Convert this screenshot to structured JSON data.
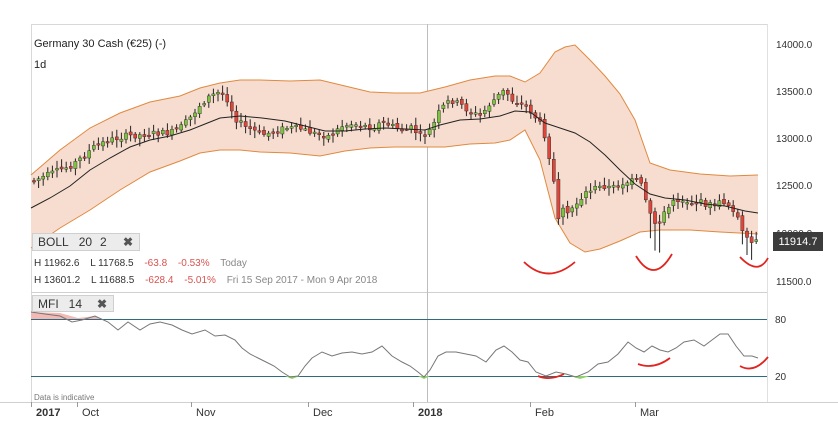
{
  "header": {
    "instrument": "Germany 30 Cash (€25) (-)",
    "timeframe": "1d"
  },
  "boll": {
    "label": "BOLL",
    "period": "20",
    "stddev": "2",
    "close_glyph": "✖"
  },
  "stats": {
    "row1": {
      "high": "H 11962.6",
      "low": "L 11768.5",
      "change": "-63.8",
      "pct": "-0.53%",
      "range": "Today"
    },
    "row2": {
      "high": "H 13601.2",
      "low": "L 11688.5",
      "change": "-628.4",
      "pct": "-5.01%",
      "range": "Fri 15 Sep 2017 - Mon 9 Apr 2018"
    }
  },
  "current_price": "11914.7",
  "mfi": {
    "label": "MFI",
    "period": "14",
    "close_glyph": "✖",
    "levels": [
      "80",
      "20"
    ]
  },
  "disclaimer": "Data is indicative",
  "x_axis": {
    "labels": [
      "2017",
      "Oct",
      "Nov",
      "Dec",
      "2018",
      "Feb",
      "Mar"
    ]
  },
  "y_axis": {
    "labels": [
      "14000.0",
      "13500.0",
      "13000.0",
      "12500.0",
      "12000.0",
      "11500.0"
    ]
  },
  "colors": {
    "up": "#7ec242",
    "down": "#e0453a",
    "band_fill": "#f7ddd0",
    "band_line": "#e0893f",
    "ma": "#222222",
    "mfi_line": "#777777",
    "annotation": "#e0241f"
  }
}
